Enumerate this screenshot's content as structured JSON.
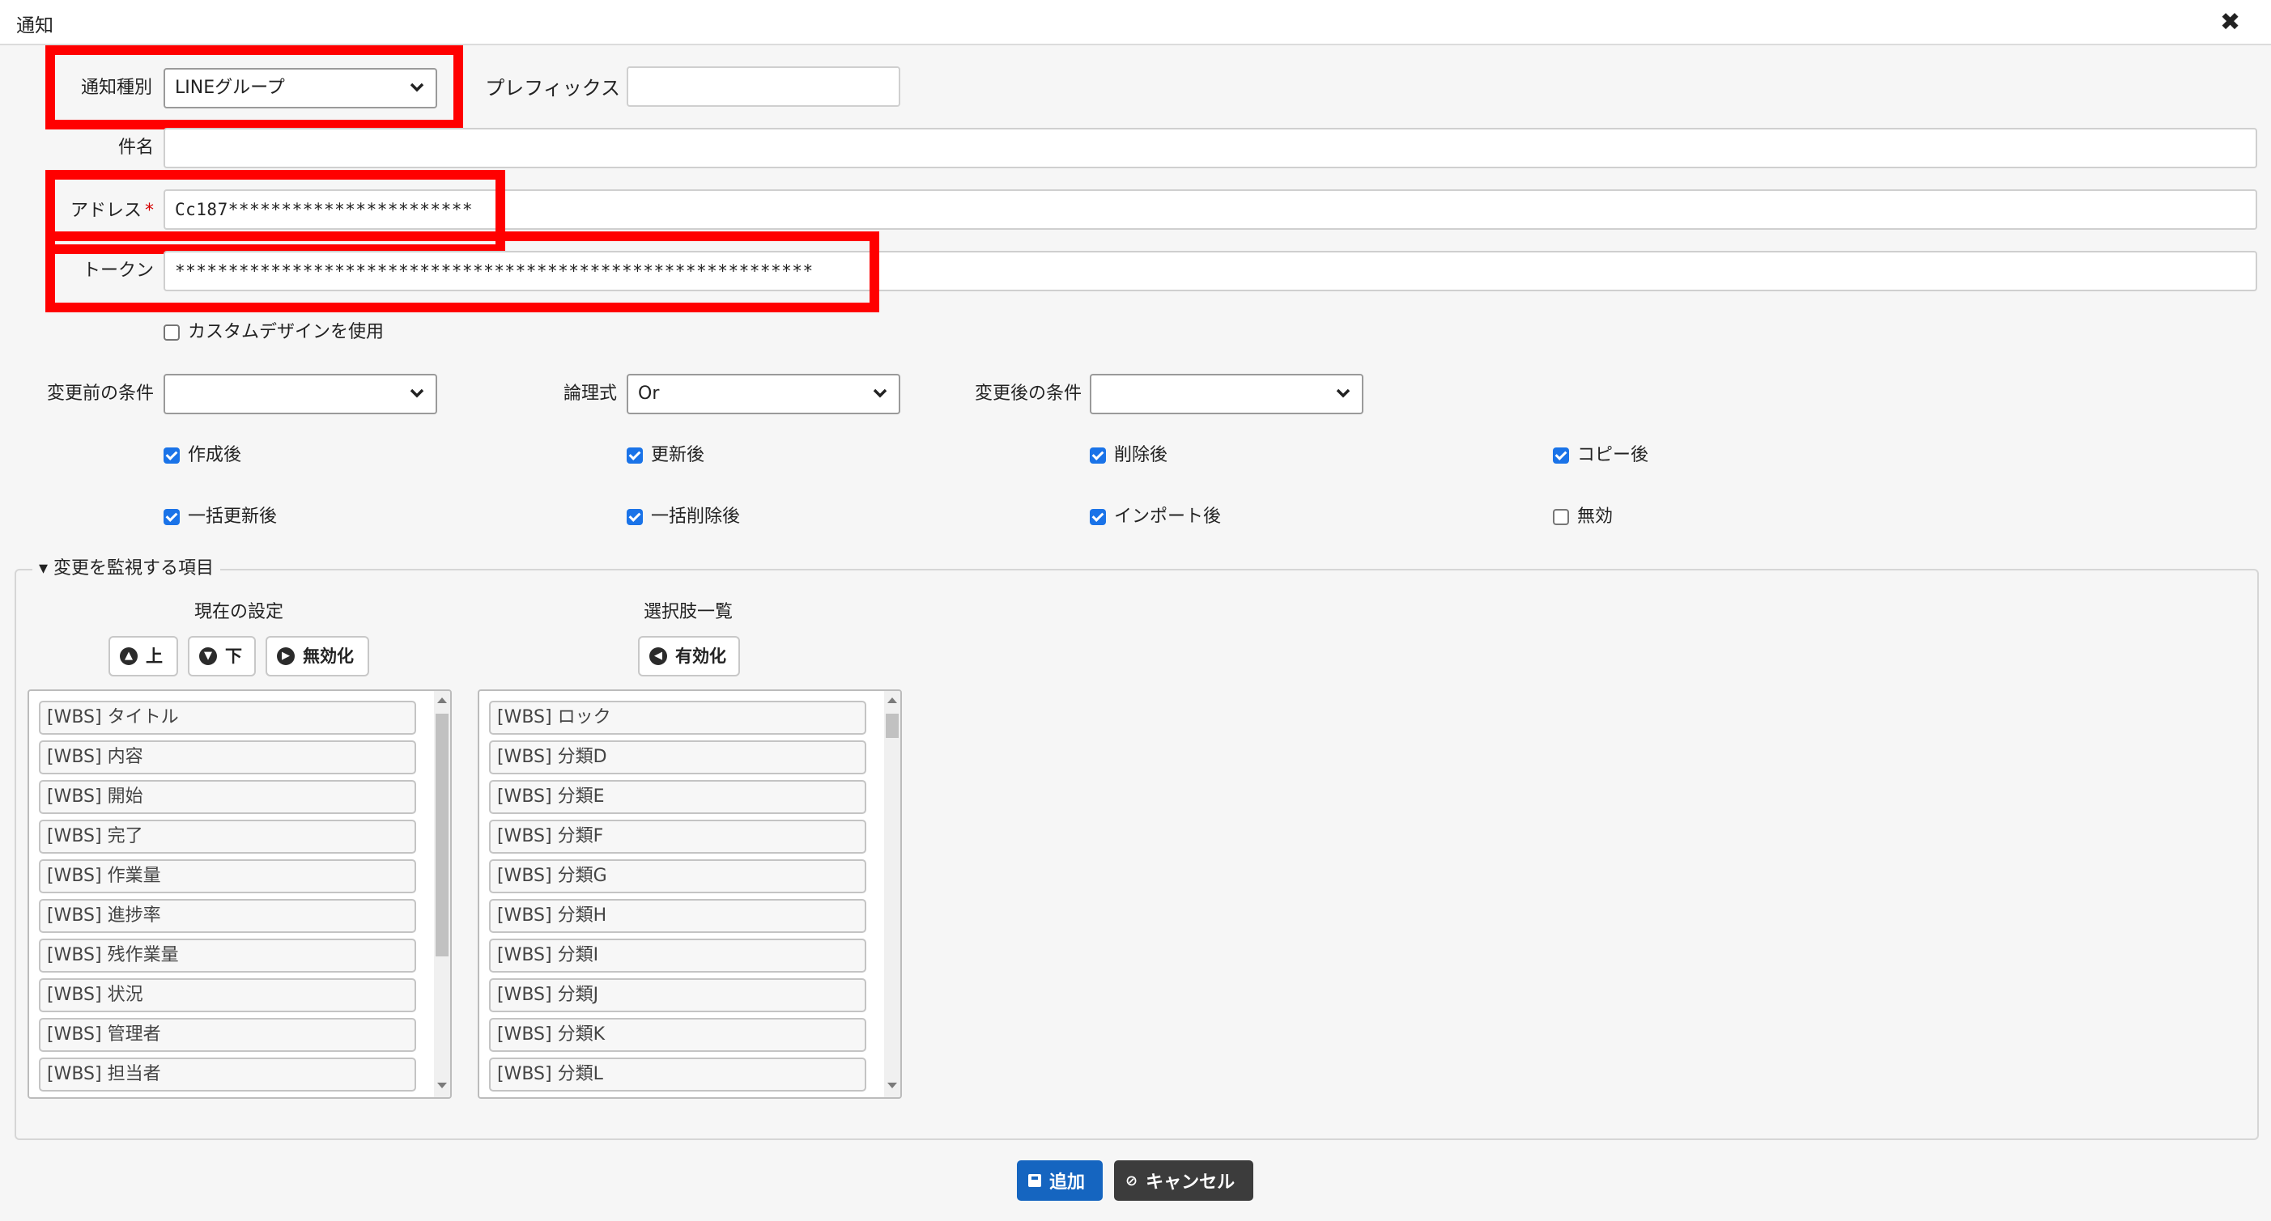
{
  "window": {
    "title": "通知",
    "close_icon": "close-icon"
  },
  "form": {
    "notify_type_label": "通知種別",
    "notify_type_value": "LINEグループ",
    "prefix_label": "プレフィックス",
    "prefix_value": "",
    "subject_label": "件名",
    "subject_value": "",
    "address_label": "アドレス",
    "address_required": "*",
    "address_value": "Cc187***********************",
    "token_label": "トークン",
    "token_value": "************************************************************",
    "custom_design_label": "カスタムデザインを使用",
    "custom_design_checked": false,
    "before_label": "変更前の条件",
    "before_value": "",
    "logic_label": "論理式",
    "logic_value": "Or",
    "after_label": "変更後の条件",
    "after_value": ""
  },
  "triggers": [
    {
      "label": "作成後",
      "checked": true
    },
    {
      "label": "更新後",
      "checked": true
    },
    {
      "label": "削除後",
      "checked": true
    },
    {
      "label": "コピー後",
      "checked": true
    },
    {
      "label": "一括更新後",
      "checked": true
    },
    {
      "label": "一括削除後",
      "checked": true
    },
    {
      "label": "インポート後",
      "checked": true
    },
    {
      "label": "無効",
      "checked": false
    }
  ],
  "monitor": {
    "legend": "変更を監視する項目",
    "current_title": "現在の設定",
    "choices_title": "選択肢一覧",
    "up_label": "上",
    "down_label": "下",
    "disable_label": "無効化",
    "enable_label": "有効化",
    "current_items": [
      "[WBS] タイトル",
      "[WBS] 内容",
      "[WBS] 開始",
      "[WBS] 完了",
      "[WBS] 作業量",
      "[WBS] 進捗率",
      "[WBS] 残作業量",
      "[WBS] 状況",
      "[WBS] 管理者",
      "[WBS] 担当者"
    ],
    "choice_items": [
      "[WBS] ロック",
      "[WBS] 分類D",
      "[WBS] 分類E",
      "[WBS] 分類F",
      "[WBS] 分類G",
      "[WBS] 分類H",
      "[WBS] 分類I",
      "[WBS] 分類J",
      "[WBS] 分類K",
      "[WBS] 分類L"
    ]
  },
  "footer": {
    "add_label": "追加",
    "cancel_label": "キャンセル"
  },
  "colors": {
    "primary": "#1565c0",
    "secondary": "#3c3c3c",
    "highlight": "#ff0000",
    "checkbox": "#1a73e8"
  }
}
